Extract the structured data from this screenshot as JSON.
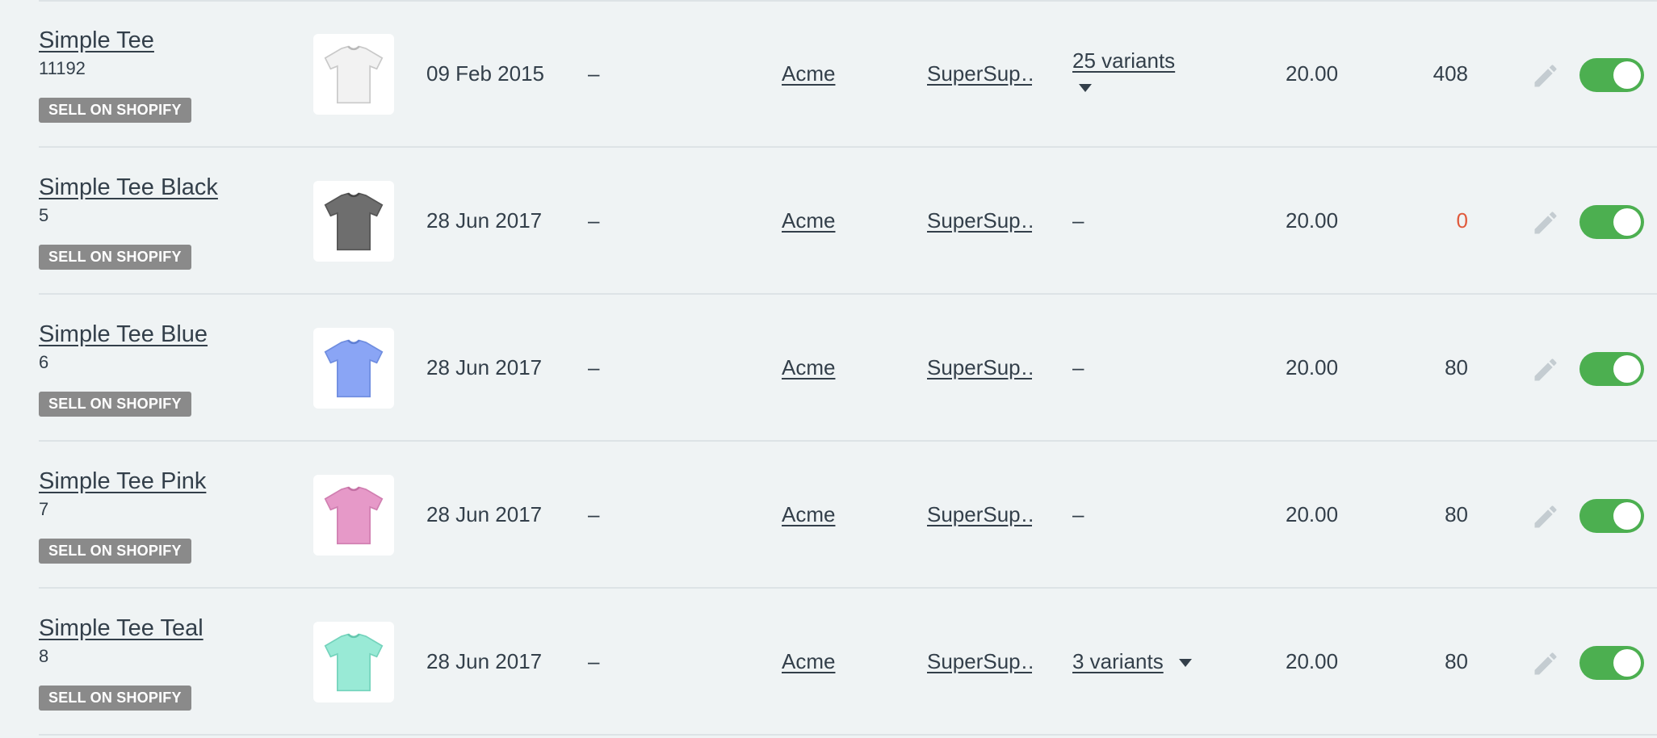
{
  "products": [
    {
      "title": "Simple Tee",
      "sku": "11192",
      "badge": "SELL ON SHOPIFY",
      "shirt_color": "#f2f2f2",
      "shirt_icon": "white-tshirt",
      "date": "09 Feb 2015",
      "dash": "–",
      "vendor": "Acme",
      "supplier": "SuperSup…",
      "variants": "25 variants",
      "price": "20.00",
      "stock": "408",
      "stock_low": false,
      "enabled": true
    },
    {
      "title": "Simple Tee Black",
      "sku": "5",
      "badge": "SELL ON SHOPIFY",
      "shirt_color": "#6e6e6e",
      "shirt_icon": "black-tshirt",
      "date": "28 Jun 2017",
      "dash": "–",
      "vendor": "Acme",
      "supplier": "SuperSup…",
      "variants": "–",
      "price": "20.00",
      "stock": "0",
      "stock_low": true,
      "enabled": true
    },
    {
      "title": "Simple Tee Blue",
      "sku": "6",
      "badge": "SELL ON SHOPIFY",
      "shirt_color": "#8aa5f5",
      "shirt_icon": "blue-tshirt",
      "date": "28 Jun 2017",
      "dash": "–",
      "vendor": "Acme",
      "supplier": "SuperSup…",
      "variants": "–",
      "price": "20.00",
      "stock": "80",
      "stock_low": false,
      "enabled": true
    },
    {
      "title": "Simple Tee Pink",
      "sku": "7",
      "badge": "SELL ON SHOPIFY",
      "shirt_color": "#e699c8",
      "shirt_icon": "pink-tshirt",
      "date": "28 Jun 2017",
      "dash": "–",
      "vendor": "Acme",
      "supplier": "SuperSup…",
      "variants": "–",
      "price": "20.00",
      "stock": "80",
      "stock_low": false,
      "enabled": true
    },
    {
      "title": "Simple Tee Teal",
      "sku": "8",
      "badge": "SELL ON SHOPIFY",
      "shirt_color": "#99ead6",
      "shirt_icon": "teal-tshirt",
      "date": "28 Jun 2017",
      "dash": "–",
      "vendor": "Acme",
      "supplier": "SuperSup…",
      "variants": "3 variants",
      "price": "20.00",
      "stock": "80",
      "stock_low": false,
      "enabled": true
    }
  ],
  "colors": {
    "toggle_on": "#4caf50",
    "badge_bg": "#8a8a8a",
    "stock_low": "#e0593b",
    "background": "#eff3f4"
  },
  "icons": {
    "edit": "pencil-icon",
    "variants_toggle": "caret-down-icon"
  }
}
